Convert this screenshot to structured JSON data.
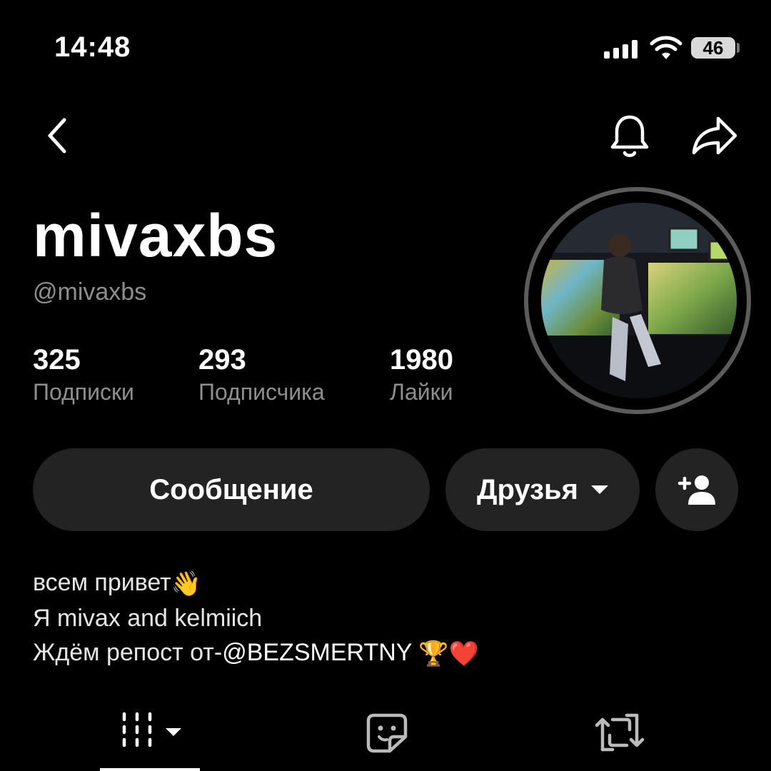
{
  "status_bar": {
    "time": "14:48",
    "battery": "46",
    "icons": [
      "cellular-signal-icon",
      "wifi-icon",
      "battery-icon"
    ]
  },
  "nav": {
    "icons": [
      "back-chevron-icon",
      "bell-icon",
      "share-arrow-icon"
    ]
  },
  "profile": {
    "display_name": "mivaxbs",
    "handle": "@mivaxbs",
    "stats": [
      {
        "value": "325",
        "label": "Подписки"
      },
      {
        "value": "293",
        "label": "Подписчика"
      },
      {
        "value": "1980",
        "label": "Лайки"
      }
    ]
  },
  "actions": {
    "message_label": "Сообщение",
    "friends_label": "Друзья",
    "add_friend_icon": "add-person-icon"
  },
  "bio": {
    "line1": "всем привет",
    "line1_emoji": "👋",
    "line2": "Я mivax and kelmiich",
    "line3_prefix": "Ждём репост от-",
    "line3_mention": "@BEZSMERTNY",
    "line3_emojis": [
      "🏆",
      "❤️"
    ]
  },
  "tabs": [
    {
      "icon": "videos-grid-icon",
      "active": true
    },
    {
      "icon": "sticker-icon",
      "active": false
    },
    {
      "icon": "repost-icon",
      "active": false
    }
  ],
  "colors": {
    "background": "#000000",
    "button_bg": "#232323",
    "secondary_text": "#8e8e8e",
    "avatar_ring": "#5c5c5c"
  }
}
